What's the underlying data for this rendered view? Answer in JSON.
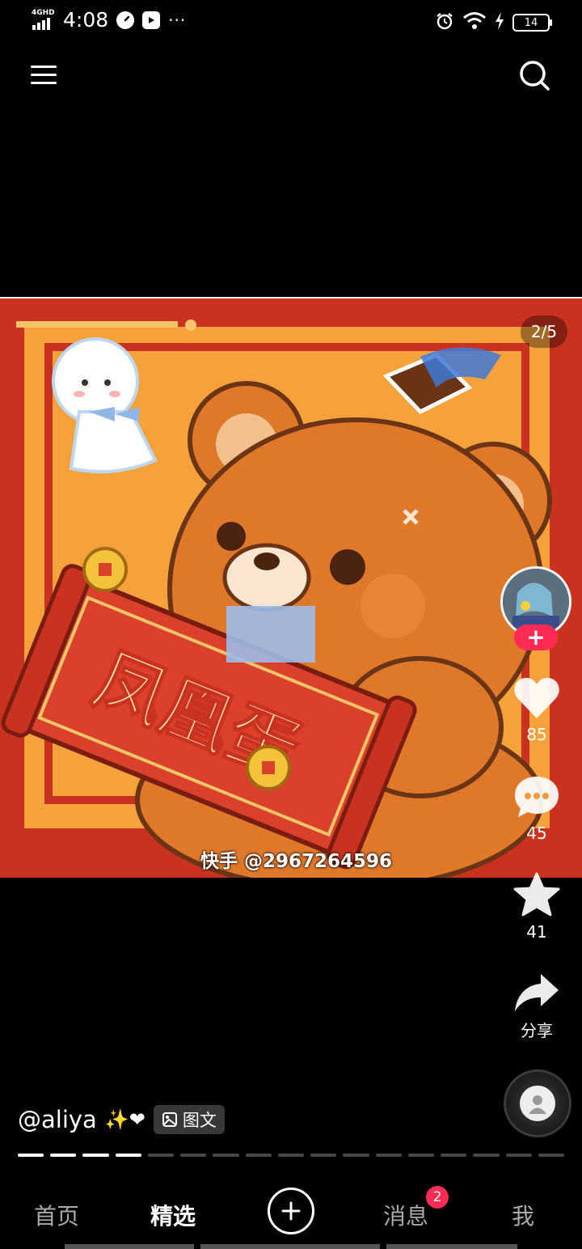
{
  "status_bar": {
    "network": "4GHD",
    "time": "4:08",
    "more": "···",
    "battery": "14"
  },
  "post": {
    "counter": "2/5",
    "watermark": "快手 @2967264596",
    "author": "@aliya",
    "emoji": "✨❤",
    "type_tag": "图文",
    "progress_total": 17,
    "progress_active": 4
  },
  "actions": {
    "follow": "+",
    "likes": "85",
    "comments": "45",
    "favorites": "41",
    "share": "分享"
  },
  "tabbar": {
    "home": "首页",
    "featured": "精选",
    "messages": "消息",
    "messages_badge": "2",
    "me": "我"
  },
  "colors": {
    "accent": "#fe2c55",
    "poster_red": "#c8321e",
    "poster_orange": "#f6a23c",
    "bear": "#e0782a"
  }
}
